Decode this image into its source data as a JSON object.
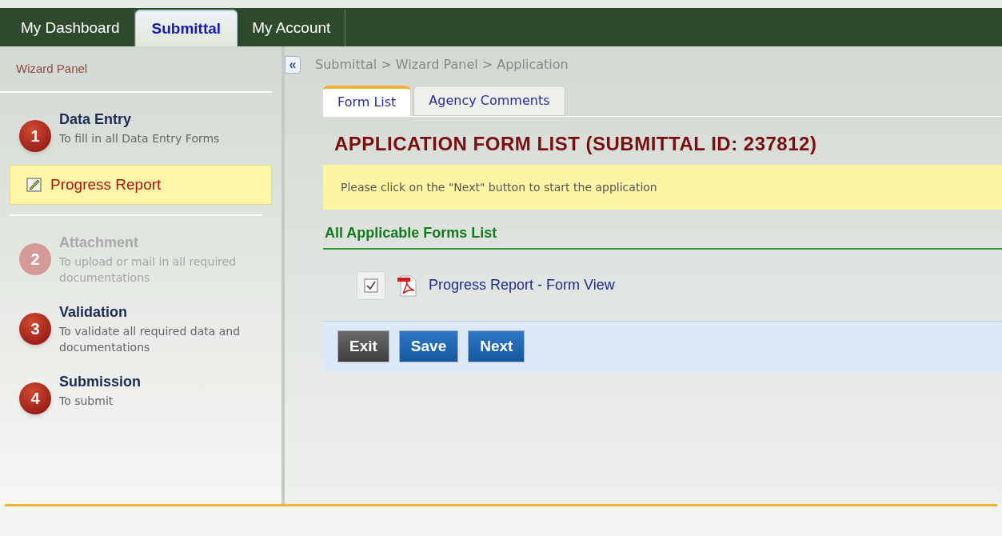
{
  "nav_tabs": [
    {
      "label": "My Dashboard",
      "selected": false
    },
    {
      "label": "Submittal",
      "selected": true
    },
    {
      "label": "My Account",
      "selected": false
    }
  ],
  "sidebar": {
    "title": "Wizard Panel",
    "steps": [
      {
        "number": "1",
        "title": "Data Entry",
        "description": "To fill in all Data Entry Forms",
        "disabled": false,
        "items": [
          {
            "label": "Progress Report",
            "selected": true
          }
        ]
      },
      {
        "number": "2",
        "title": "Attachment",
        "description": "To upload or mail in all required documentations",
        "disabled": true
      },
      {
        "number": "3",
        "title": "Validation",
        "description": "To validate all required data and documentations",
        "disabled": false
      },
      {
        "number": "4",
        "title": "Submission",
        "description": "To submit",
        "disabled": false
      }
    ]
  },
  "collapse_button": "«",
  "breadcrumb": "Submittal > Wizard Panel > Application",
  "tabs": [
    {
      "label": "Form List",
      "selected": true
    },
    {
      "label": "Agency Comments",
      "selected": false
    }
  ],
  "heading": "APPLICATION FORM LIST (SUBMITTAL ID: 237812)",
  "notice": "Please click on the \"Next\" button to start the application",
  "section_title": "All Applicable Forms List",
  "forms": [
    {
      "label": "Progress Report - Form View",
      "checked": true
    }
  ],
  "buttons": [
    {
      "label": "Exit",
      "kind": "neutral"
    },
    {
      "label": "Save",
      "kind": "primary"
    },
    {
      "label": "Next",
      "kind": "primary"
    }
  ]
}
